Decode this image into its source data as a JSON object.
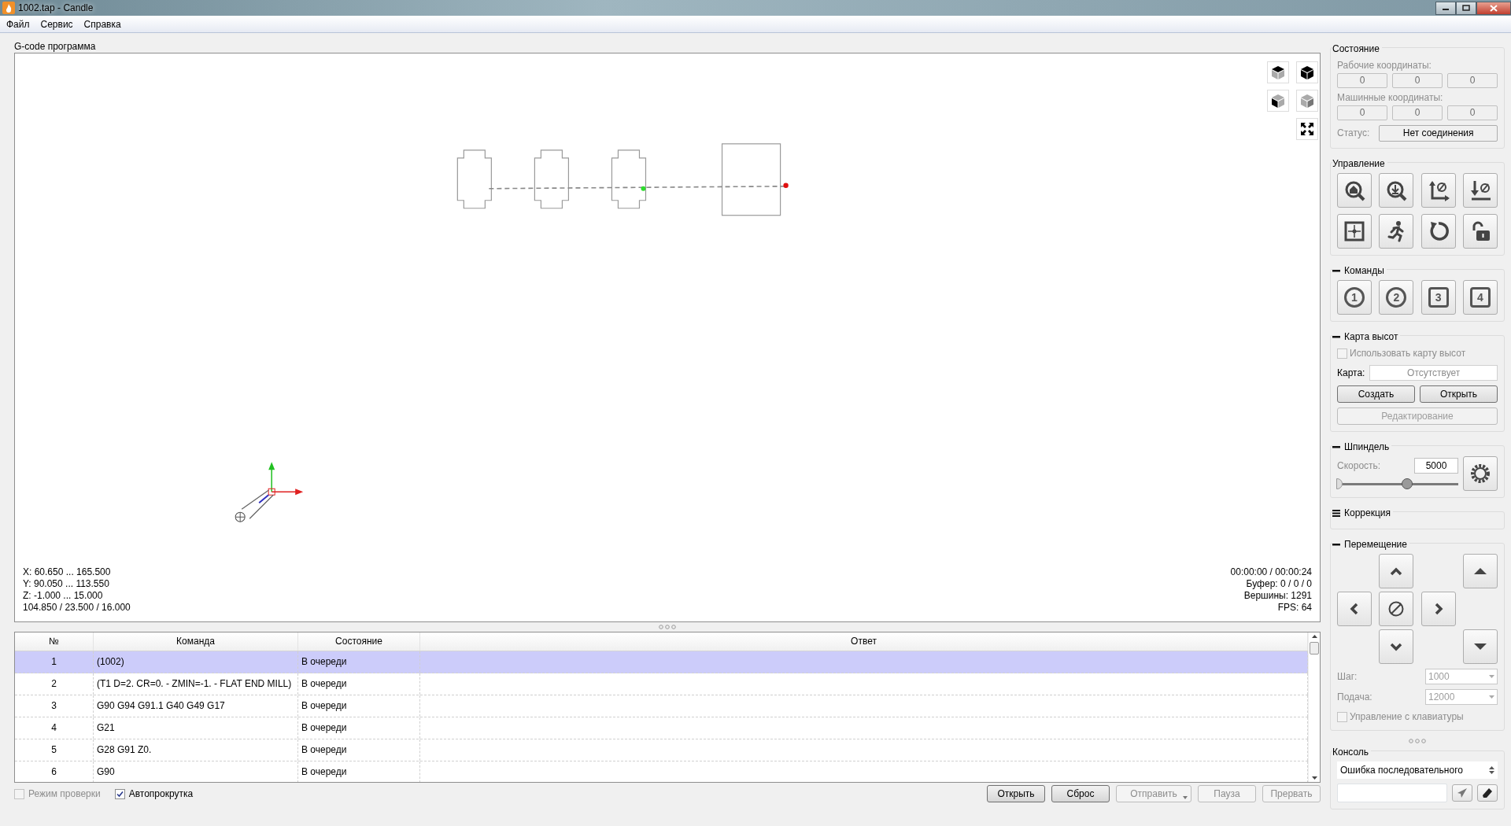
{
  "window": {
    "title": "1002.tap - Candle"
  },
  "menu": [
    {
      "label": "Файл"
    },
    {
      "label": "Сервис"
    },
    {
      "label": "Справка"
    }
  ],
  "program": {
    "title": "G-code программа",
    "bounds": [
      "X: 60.650 ... 165.500",
      "Y: 90.050 ... 113.550",
      "Z: -1.000 ... 15.000",
      "104.850 / 23.500 / 16.000"
    ],
    "info": [
      "00:00:00 / 00:00:24",
      "Буфер: 0 / 0 / 0",
      "Вершины: 1291",
      "FPS: 64"
    ]
  },
  "table": {
    "columns": [
      "№",
      "Команда",
      "Состояние",
      "Ответ"
    ],
    "rows": [
      {
        "number": "1",
        "command": "(1002)",
        "state": "В очереди",
        "selected": true
      },
      {
        "number": "2",
        "command": "(T1  D=2. CR=0. - ZMIN=-1. - FLAT END MILL)",
        "state": "В очереди",
        "selected": false
      },
      {
        "number": "3",
        "command": "G90 G94 G91.1 G40 G49 G17",
        "state": "В очереди",
        "selected": false
      },
      {
        "number": "4",
        "command": "G21",
        "state": "В очереди",
        "selected": false
      },
      {
        "number": "5",
        "command": "G28 G91 Z0.",
        "state": "В очереди",
        "selected": false
      },
      {
        "number": "6",
        "command": "G90",
        "state": "В очереди",
        "selected": false
      }
    ]
  },
  "options": [
    {
      "label": "Режим проверки",
      "checked": false,
      "disabled": true
    },
    {
      "label": "Автопрокрутка",
      "checked": true,
      "disabled": false
    }
  ],
  "actions": [
    {
      "label": "Открыть",
      "disabled": false,
      "dropdown": false
    },
    {
      "label": "Сброс",
      "disabled": false,
      "dropdown": false
    },
    {
      "label": "Отправить",
      "disabled": true,
      "dropdown": true
    },
    {
      "label": "Пауза",
      "disabled": true,
      "dropdown": false
    },
    {
      "label": "Прервать",
      "disabled": true,
      "dropdown": false
    }
  ],
  "state": {
    "title": "Состояние",
    "work_label": "Рабочие координаты:",
    "work": [
      "0",
      "0",
      "0"
    ],
    "machine_label": "Машинные координаты:",
    "machine": [
      "0",
      "0",
      "0"
    ],
    "status_label": "Статус:",
    "status": "Нет соединения"
  },
  "control": {
    "title": "Управление"
  },
  "commands": {
    "title": "Команды",
    "expanded": true,
    "buttons": [
      {
        "label": "1",
        "kind": "circle"
      },
      {
        "label": "2",
        "kind": "circle"
      },
      {
        "label": "3",
        "kind": "square"
      },
      {
        "label": "4",
        "kind": "square"
      }
    ]
  },
  "heightmap": {
    "title": "Карта высот",
    "expanded": true,
    "use_label": "Использовать карту высот",
    "use_checked": false,
    "map_label": "Карта:",
    "map_value": "Отсутствует",
    "create": "Создать",
    "open": "Открыть",
    "edit": "Редактирование",
    "edit_disabled": true
  },
  "spindle": {
    "title": "Шпиндель",
    "expanded": true,
    "speed_label": "Скорость:",
    "speed": "5000",
    "level": 0.58
  },
  "correction": {
    "title": "Коррекция",
    "expanded": false
  },
  "jog": {
    "title": "Перемещение",
    "expanded": true,
    "step_label": "Шаг:",
    "step": "1000",
    "feed_label": "Подача:",
    "feed": "12000",
    "keyboard_label": "Управление с клавиатуры",
    "keyboard_checked": false
  },
  "console": {
    "title": "Консоль",
    "log": "Ошибка последовательного"
  }
}
